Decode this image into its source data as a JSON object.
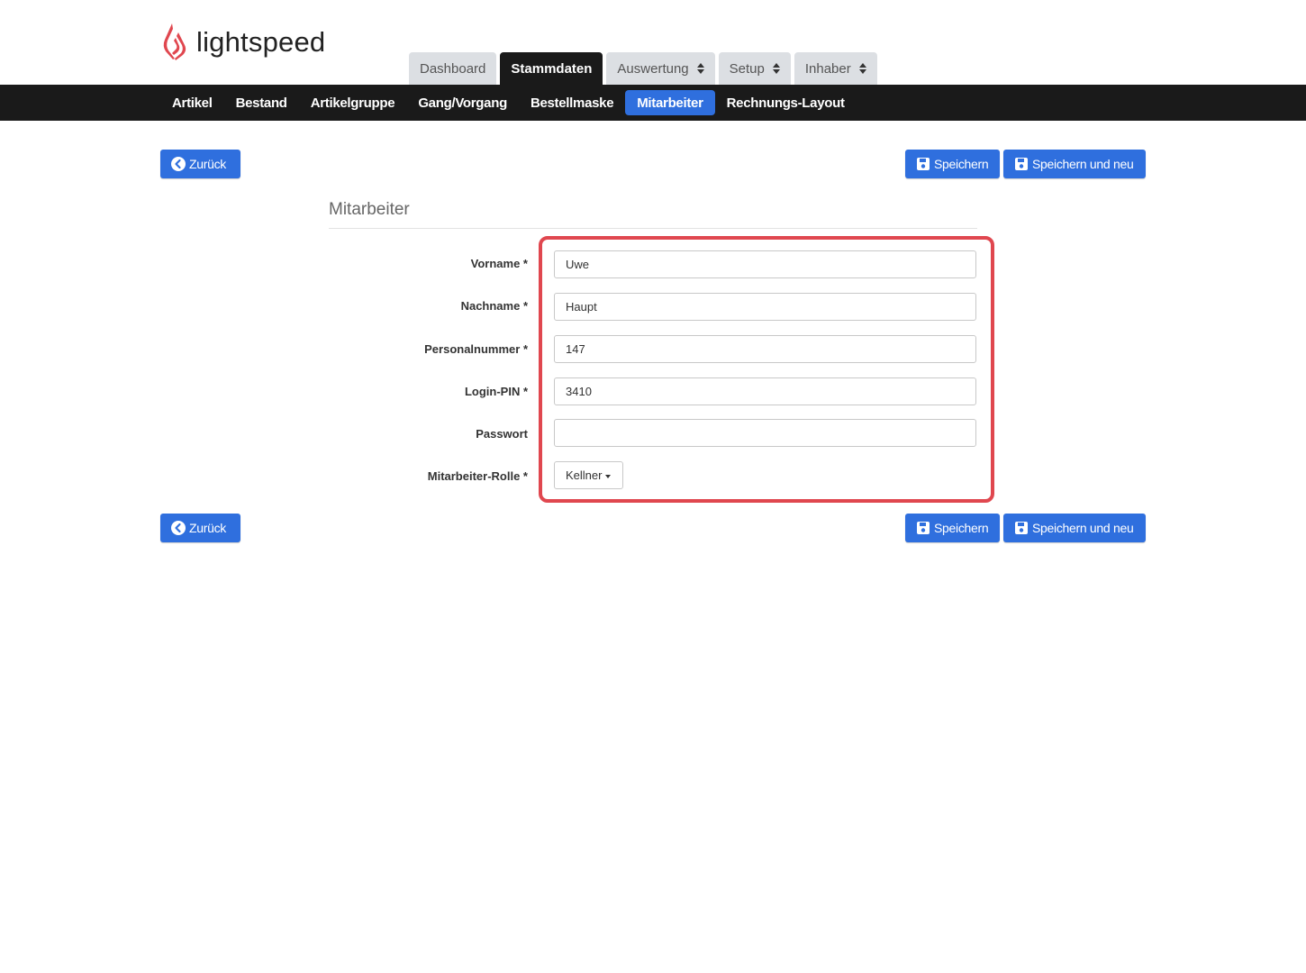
{
  "brand": {
    "name": "lightspeed",
    "logo_color": "#e0474f"
  },
  "main_tabs": [
    {
      "label": "Dashboard",
      "active": false,
      "dropdown": false
    },
    {
      "label": "Stammdaten",
      "active": true,
      "dropdown": false
    },
    {
      "label": "Auswertung",
      "active": false,
      "dropdown": true
    },
    {
      "label": "Setup",
      "active": false,
      "dropdown": true
    },
    {
      "label": "Inhaber",
      "active": false,
      "dropdown": true
    }
  ],
  "sub_nav": [
    {
      "label": "Artikel",
      "active": false
    },
    {
      "label": "Bestand",
      "active": false
    },
    {
      "label": "Artikelgruppe",
      "active": false
    },
    {
      "label": "Gang/Vorgang",
      "active": false
    },
    {
      "label": "Bestellmaske",
      "active": false
    },
    {
      "label": "Mitarbeiter",
      "active": true
    },
    {
      "label": "Rechnungs-Layout",
      "active": false
    }
  ],
  "actions": {
    "back_label": "Zurück",
    "save_label": "Speichern",
    "save_new_label": "Speichern und neu"
  },
  "form": {
    "title": "Mitarbeiter",
    "fields": {
      "vorname": {
        "label": "Vorname *",
        "value": "Uwe"
      },
      "nachname": {
        "label": "Nachname *",
        "value": "Haupt"
      },
      "personalnummer": {
        "label": "Personalnummer *",
        "value": "147"
      },
      "login_pin": {
        "label": "Login-PIN *",
        "value": "3410"
      },
      "passwort": {
        "label": "Passwort",
        "value": ""
      },
      "rolle": {
        "label": "Mitarbeiter-Rolle *",
        "value": "Kellner"
      }
    }
  },
  "colors": {
    "accent": "#2f6fde",
    "nav_bg": "#1a1a1a",
    "highlight": "#e0474f"
  }
}
